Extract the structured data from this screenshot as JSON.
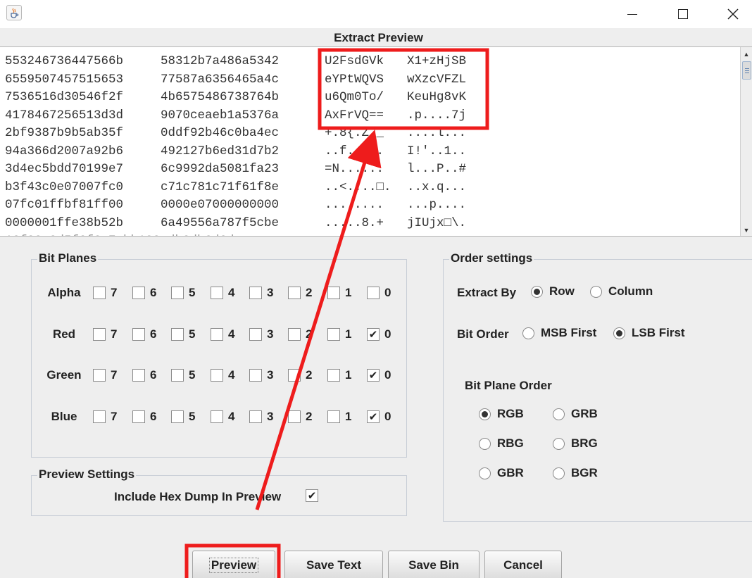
{
  "window": {
    "icon": "java-coffee-icon",
    "minimize_glyph": "—",
    "maximize_glyph": "☐",
    "close_glyph": "✕"
  },
  "preview": {
    "title": "Extract Preview",
    "hex_col1": [
      "553246736447566b",
      "6559507457515653",
      "7536516d30546f2f",
      "4178467256513d3d",
      "2bf9387b9b5ab35f",
      "94a366d2007a92b6",
      "3d4ec5bdd70199e7",
      "b3f43c0e07007fc0",
      "07fc01ffbf81ff00",
      "0000001ffe38b52b"
    ],
    "hex_col2": [
      "58312b7a486a5342",
      "77587a6356465a4c",
      "4b6575486738764b",
      "9070ceaeb1a5376a",
      "0ddf92b46c0ba4ec",
      "492127b6ed31d7b2",
      "6c9992da5081fa23",
      "c71c781c71f61f8e",
      "0000e07000000000",
      "6a49556a787f5cbe"
    ],
    "ascii_col1": [
      "U2FsdGVk",
      "eYPtWQVS",
      "u6Qm0To/",
      "AxFrVQ==",
      "+.8{.Z._",
      "..f..z..",
      "=N......",
      "..<....□.",
      "........",
      ".....8.+"
    ],
    "ascii_col2": [
      "X1+zHjSB",
      "wXzcVFZL",
      "KeuHg8vK",
      ".p....7j",
      "....l...",
      "I!'..1..",
      "l...P..#",
      "..x.q...",
      "...p....",
      "jIUjx□\\."
    ]
  },
  "bit_planes": {
    "title": "Bit Planes",
    "bits": [
      "7",
      "6",
      "5",
      "4",
      "3",
      "2",
      "1",
      "0"
    ],
    "rows": [
      {
        "label": "Alpha",
        "checked": [
          false,
          false,
          false,
          false,
          false,
          false,
          false,
          false
        ]
      },
      {
        "label": "Red",
        "checked": [
          false,
          false,
          false,
          false,
          false,
          false,
          false,
          true
        ]
      },
      {
        "label": "Green",
        "checked": [
          false,
          false,
          false,
          false,
          false,
          false,
          false,
          true
        ]
      },
      {
        "label": "Blue",
        "checked": [
          false,
          false,
          false,
          false,
          false,
          false,
          false,
          true
        ]
      }
    ],
    "check_glyph": "✔"
  },
  "preview_settings": {
    "title": "Preview Settings",
    "include_hex_label": "Include Hex Dump In Preview",
    "include_hex_checked": true
  },
  "order_settings": {
    "title": "Order settings",
    "extract_by_label": "Extract By",
    "extract_options": [
      {
        "label": "Row",
        "selected": true
      },
      {
        "label": "Column",
        "selected": false
      }
    ],
    "bit_order_label": "Bit Order",
    "bit_order_options": [
      {
        "label": "MSB First",
        "selected": false
      },
      {
        "label": "LSB First",
        "selected": true
      }
    ],
    "plane_order_label": "Bit Plane Order",
    "plane_order_options": [
      {
        "label": "RGB",
        "selected": true
      },
      {
        "label": "GRB",
        "selected": false
      },
      {
        "label": "RBG",
        "selected": false
      },
      {
        "label": "BRG",
        "selected": false
      },
      {
        "label": "GBR",
        "selected": false
      },
      {
        "label": "BGR",
        "selected": false
      }
    ]
  },
  "buttons": {
    "preview": "Preview",
    "save_text": "Save Text",
    "save_bin": "Save Bin",
    "cancel": "Cancel"
  },
  "annotation": {
    "color": "#ee1c1c"
  }
}
